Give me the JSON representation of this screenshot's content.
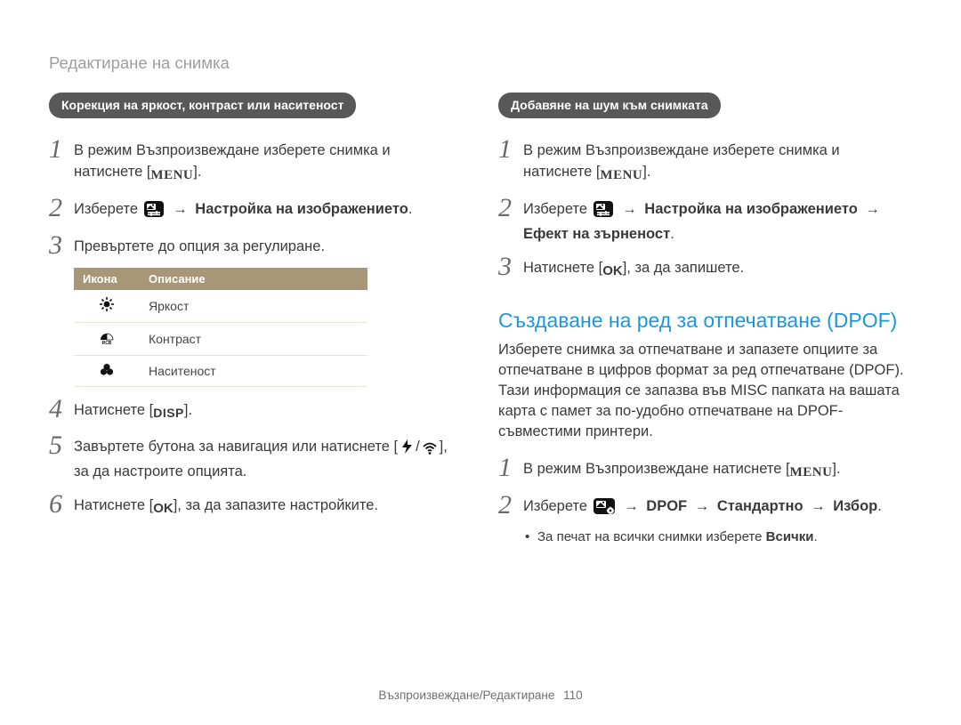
{
  "breadcrumb": "Редактиране на снимка",
  "left": {
    "pill": "Корекция на яркост, контраст или наситеност",
    "step1_a": "В режим Възпроизвеждане изберете снимка и натиснете [",
    "step1_menu": "MENU",
    "step1_b": "].",
    "step2_a": "Изберете ",
    "step2_arrow": " → ",
    "step2_b": "Настройка на изображението",
    "step2_c": ".",
    "step3": "Превъртете до опция за регулиране.",
    "table": {
      "h1": "Икона",
      "h2": "Описание",
      "r1": "Яркост",
      "r2": "Контраст",
      "r3": "Наситеност"
    },
    "step4_a": "Натиснете [",
    "step4_disp": "DISP",
    "step4_b": "].",
    "step5_a": "Завъртете бутона за навигация или натиснете [",
    "step5_sep": "/",
    "step5_b": "], за да настроите опцията.",
    "step6_a": "Натиснете [",
    "step6_ok": "OK",
    "step6_b": "], за да запазите настройките."
  },
  "right": {
    "pill": "Добавяне на шум към снимката",
    "step1_a": "В режим Възпроизвеждане изберете снимка и натиснете [",
    "step1_menu": "MENU",
    "step1_b": "].",
    "step2_a": "Изберете ",
    "step2_arrow": " → ",
    "step2_b": "Настройка на изображението",
    "step2_arrow2": " → ",
    "step2_c": "Ефект на зърненост",
    "step2_d": ".",
    "step3_a": "Натиснете [",
    "step3_ok": "OK",
    "step3_b": "], за да запишете.",
    "h2": "Създаване на ред за отпечатване (DPOF)",
    "para": "Изберете снимка за отпечатване и запазете опциите за отпечатване в цифров формат за ред отпечатване (DPOF). Тази информация се запазва във MISC папката на вашата карта с памет за по-удобно отпечатване на DPOF-съвместими принтери.",
    "dstep1_a": "В режим Възпроизвеждане натиснете [",
    "dstep1_menu": "MENU",
    "dstep1_b": "].",
    "dstep2_a": "Изберете ",
    "dstep2_arrow": " → ",
    "dstep2_b": "DPOF",
    "dstep2_arrow2": " → ",
    "dstep2_c": "Стандартно",
    "dstep2_arrow3": " → ",
    "dstep2_d": "Избор",
    "dstep2_e": ".",
    "bullet_a": "За печат на всички снимки изберете ",
    "bullet_b": "Всички",
    "bullet_c": "."
  },
  "footer": {
    "section": "Възпроизвеждане/Редактиране",
    "page": "110"
  }
}
